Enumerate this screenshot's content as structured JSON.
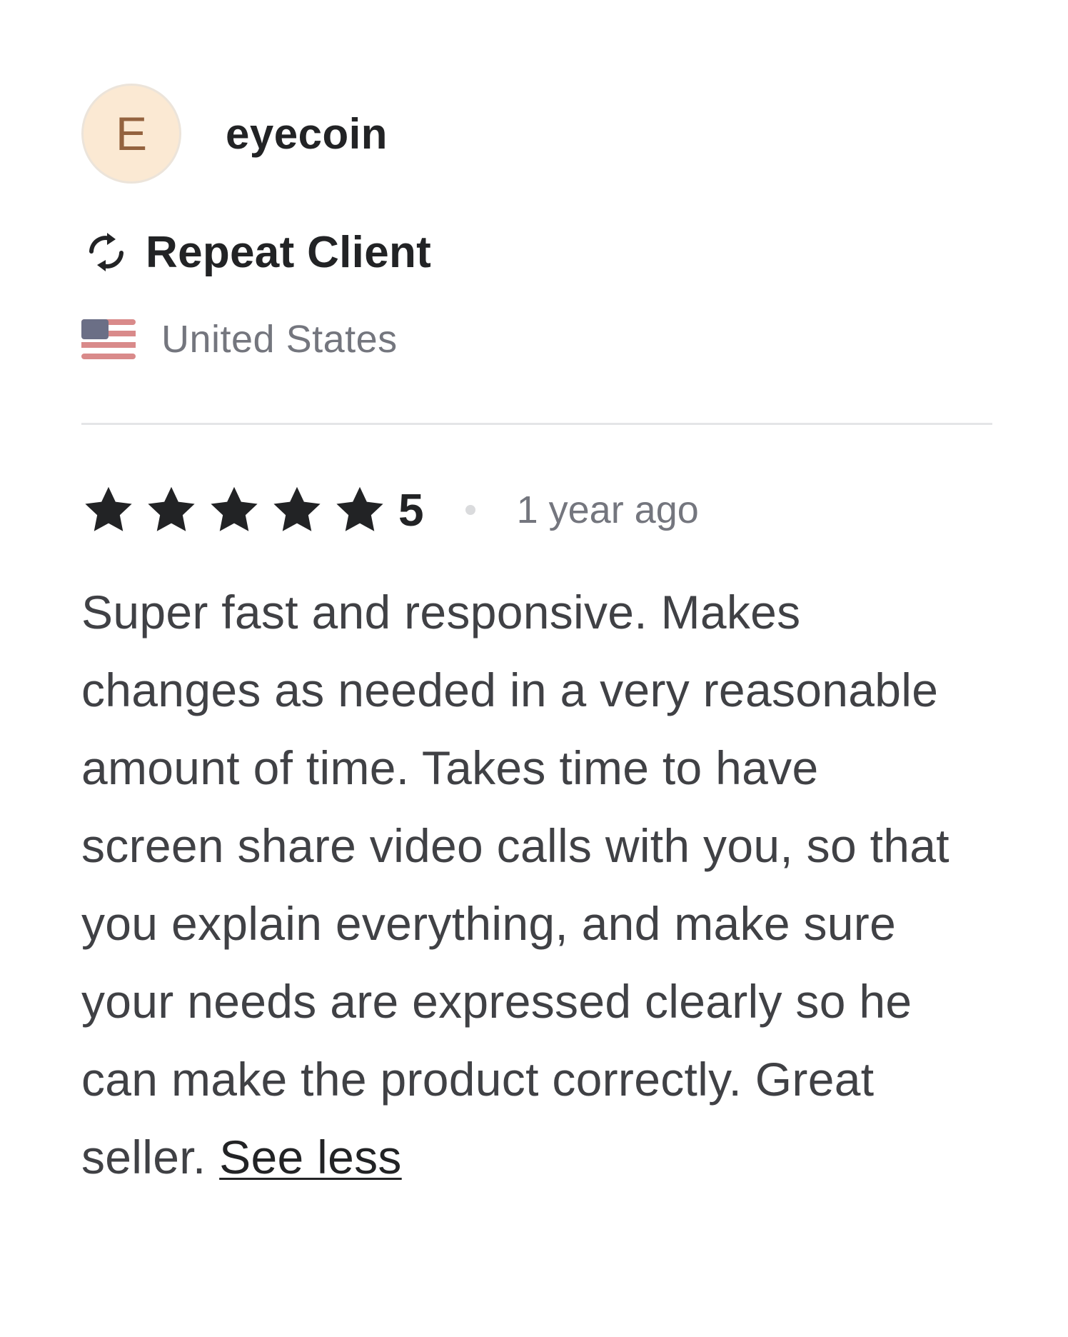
{
  "reviewer": {
    "avatar_initial": "E",
    "username": "eyecoin",
    "badge_label": "Repeat Client",
    "badge_icon": "repeat-icon",
    "country": "United States",
    "flag_icon": "us-flag-icon"
  },
  "review": {
    "stars_filled": 5,
    "stars_total": 5,
    "rating": "5",
    "time_ago": "1 year ago",
    "text": "Super fast and responsive. Makes changes as needed in a very reasonable amount of time. Takes time to have screen share video calls with you, so that you explain everything, and make sure your needs are expressed clearly so he can make the product correctly. Great seller.",
    "toggle_label": "See less"
  },
  "colors": {
    "avatar_bg": "#fbe9d3",
    "avatar_text": "#94633f",
    "primary_text": "#222325",
    "secondary_text": "#74767e",
    "body_text": "#404145",
    "divider": "#e4e5e7"
  }
}
